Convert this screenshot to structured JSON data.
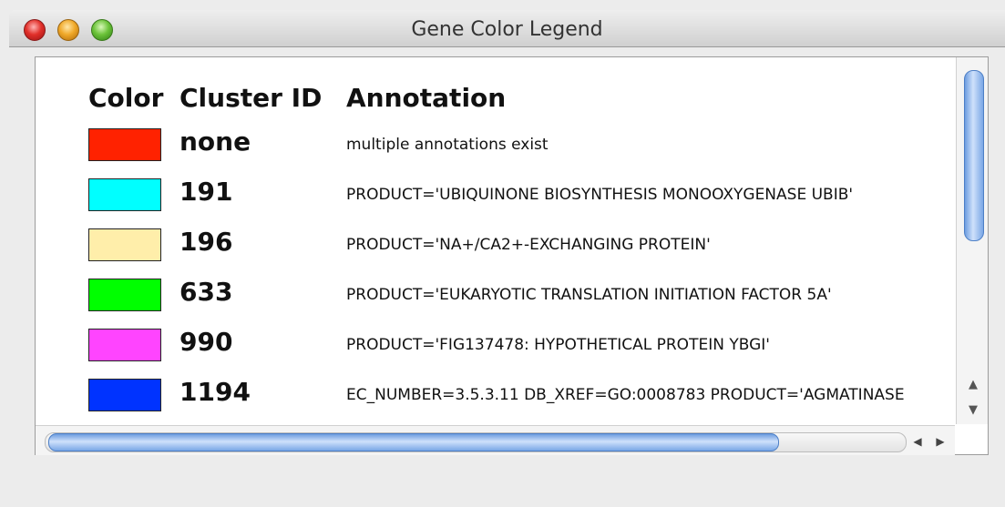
{
  "window": {
    "title": "Gene Color Legend"
  },
  "headers": {
    "color": "Color",
    "cluster_id": "Cluster ID",
    "annotation": "Annotation"
  },
  "rows": [
    {
      "color": "#ff2200",
      "cluster_id": "none",
      "annotation": "multiple annotations exist"
    },
    {
      "color": "#00ffff",
      "cluster_id": "191",
      "annotation": "PRODUCT='UBIQUINONE BIOSYNTHESIS MONOOXYGENASE UBIB'"
    },
    {
      "color": "#ffeeaa",
      "cluster_id": "196",
      "annotation": "PRODUCT='NA+/CA2+-EXCHANGING PROTEIN'"
    },
    {
      "color": "#00ff00",
      "cluster_id": "633",
      "annotation": "PRODUCT='EUKARYOTIC TRANSLATION INITIATION FACTOR 5A'"
    },
    {
      "color": "#ff44ff",
      "cluster_id": "990",
      "annotation": "PRODUCT='FIG137478: HYPOTHETICAL PROTEIN YBGI'"
    },
    {
      "color": "#0033ff",
      "cluster_id": "1194",
      "annotation": "EC_NUMBER=3.5.3.11 DB_XREF=GO:0008783 PRODUCT='AGMATINASE"
    }
  ],
  "scrollbar": {
    "up_arrow": "▲",
    "down_arrow": "▼",
    "left_arrow": "◀",
    "right_arrow": "▶"
  }
}
